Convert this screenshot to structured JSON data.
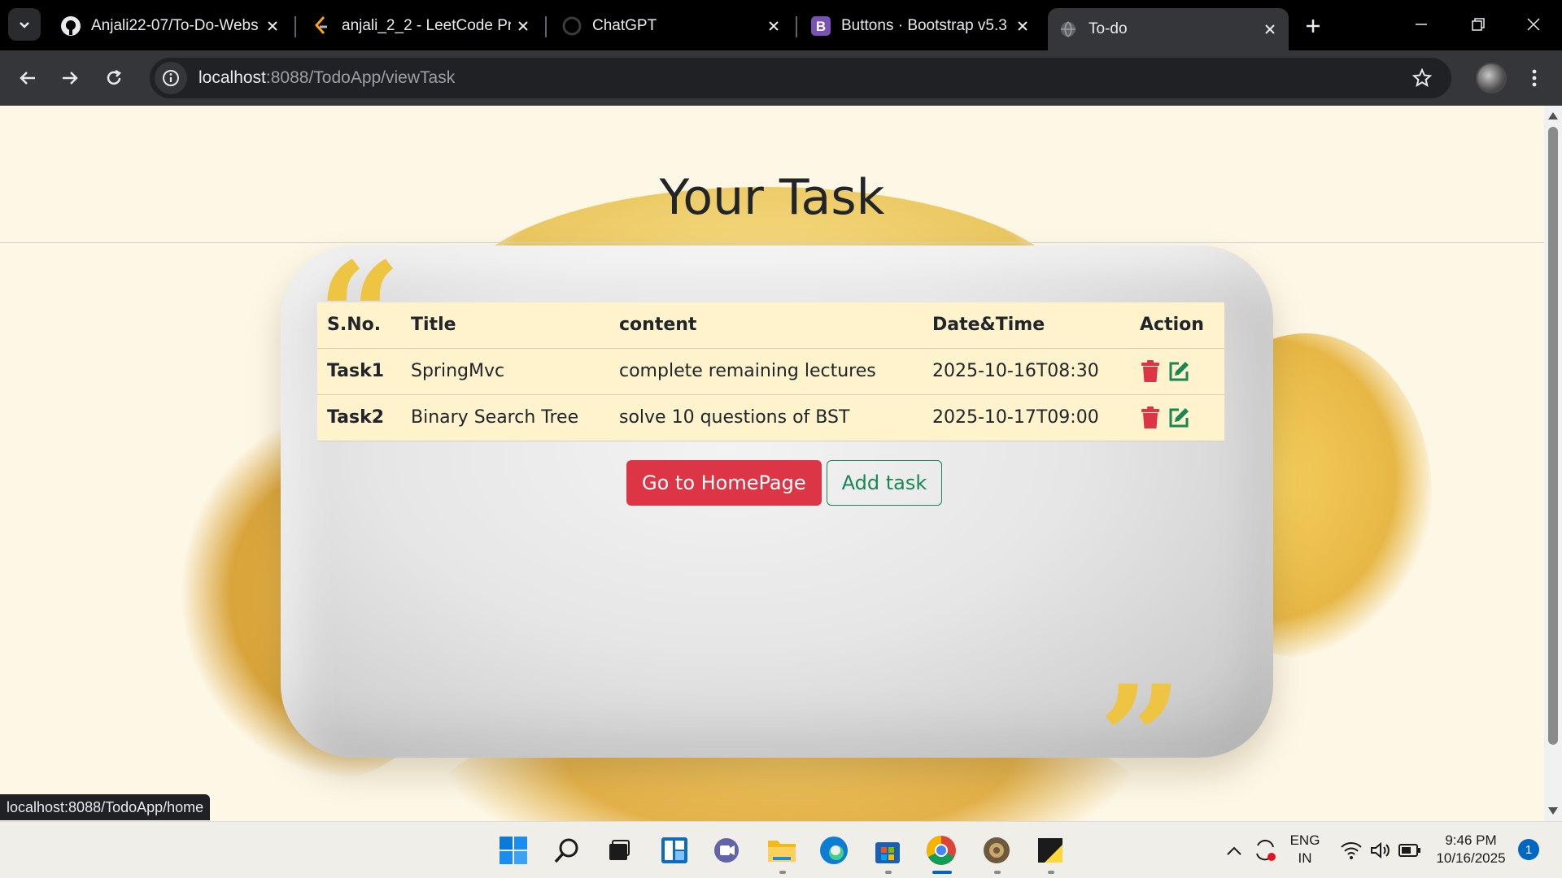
{
  "browser": {
    "tabs": [
      {
        "title": "Anjali22-07/To-Do-Webs",
        "favicon": "github-icon"
      },
      {
        "title": "anjali_2_2 - LeetCode Pro",
        "favicon": "leetcode-icon"
      },
      {
        "title": "ChatGPT",
        "favicon": "chatgpt-icon"
      },
      {
        "title": "Buttons · Bootstrap v5.3",
        "favicon": "bootstrap-icon"
      },
      {
        "title": "To-do",
        "favicon": "globe-icon",
        "active": true
      }
    ],
    "url_host": "localhost",
    "url_path": ":8088/TodoApp/viewTask",
    "status_url": "localhost:8088/TodoApp/home"
  },
  "page": {
    "heading": "Your Task",
    "table": {
      "headers": [
        "S.No.",
        "Title",
        "content",
        "Date&Time",
        "Action"
      ],
      "rows": [
        {
          "sno": "Task1",
          "title": "SpringMvc",
          "content": "complete remaining lectures",
          "datetime": "2025-10-16T08:30"
        },
        {
          "sno": "Task2",
          "title": "Binary Search Tree",
          "content": "solve 10 questions of BST",
          "datetime": "2025-10-17T09:00"
        }
      ]
    },
    "buttons": {
      "home": "Go to HomePage",
      "add": "Add task"
    }
  },
  "taskbar": {
    "language": "ENG",
    "region": "IN",
    "time": "9:46 PM",
    "date": "10/16/2025",
    "notifications": "1"
  },
  "colors": {
    "danger": "#dc3545",
    "success": "#198754",
    "table_bg": "#fff3cd",
    "page_bg": "#fdf7e6"
  }
}
